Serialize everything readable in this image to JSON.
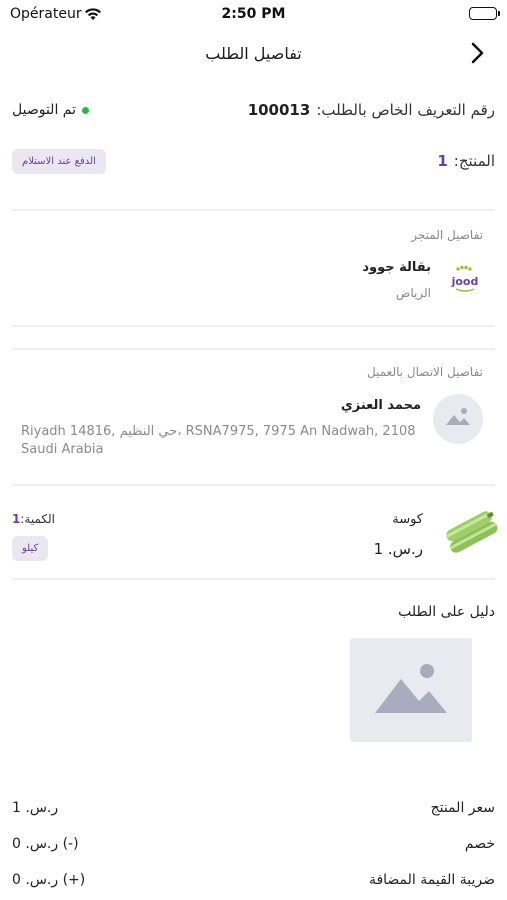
{
  "status_bar": {
    "carrier": "Opérateur",
    "time": "2:50 PM"
  },
  "header": {
    "title": "تفاصيل الطلب",
    "back_icon": "chevron-right-icon"
  },
  "order": {
    "id_label": "رقم التعريف الخاص بالطلب:",
    "id_value": "100013",
    "status": "تم التوصيل",
    "status_color": "#28b84c",
    "product_label": "المنتج:",
    "product_count": "1",
    "payment_method": "الدفع عند الاستلام"
  },
  "store": {
    "section_title": "تفاصيل المتجر",
    "name": "بقالة جوود",
    "city": "الرياض",
    "logo_text": "jood"
  },
  "customer": {
    "section_title": "تفاصيل الاتصال بالعميل",
    "name": "محمد العنزي",
    "address": "Riyadh 14816, حي النظيم، RSNA7975, 7975 An Nadwah, 2108 Saudi Arabia"
  },
  "item": {
    "name": "كوسة",
    "price": "ر.س. 1",
    "qty_label": "الكمية:",
    "qty_value": "1",
    "unit": "كيلو"
  },
  "proof": {
    "title": "دليل على الطلب"
  },
  "summary": [
    {
      "label": "سعر المنتج",
      "value": "ر.س. 1"
    },
    {
      "label": "خصم",
      "value": "(-) ر.س. 0"
    },
    {
      "label": "ضريبة القيمة المضافة",
      "value": "(+) ر.س. 0"
    }
  ],
  "colors": {
    "accent": "#6b3fa0",
    "pill_bg": "#ebe7f0",
    "placeholder_bg": "#e8eaf0",
    "muted": "#8a8a8a"
  }
}
